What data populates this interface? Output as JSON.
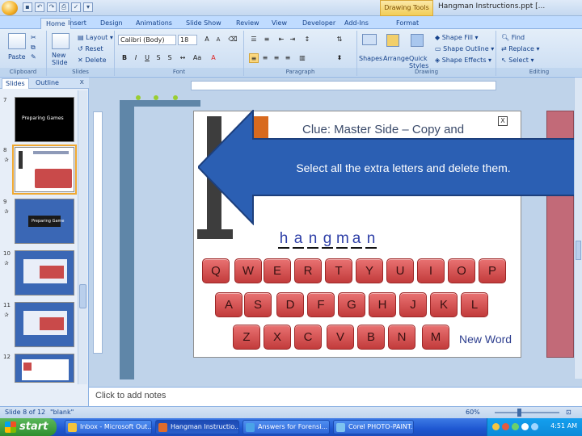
{
  "titlebar": {
    "context_tab": "Drawing Tools",
    "document_title": "Hangman Instructions.ppt [..."
  },
  "ribbon_tabs": [
    "Home",
    "Insert",
    "Design",
    "Animations",
    "Slide Show",
    "Review",
    "View",
    "Developer",
    "Add-Ins",
    "Format"
  ],
  "ribbon": {
    "clipboard": {
      "paste": "Paste",
      "label": "Clipboard"
    },
    "slides": {
      "new_slide": "New Slide",
      "layout": "Layout",
      "reset": "Reset",
      "delete": "Delete",
      "label": "Slides"
    },
    "font": {
      "font_name": "Calibri (Body)",
      "font_size": "18",
      "label": "Font"
    },
    "paragraph": {
      "label": "Paragraph"
    },
    "drawing": {
      "shapes": "Shapes",
      "arrange": "Arrange",
      "quick_styles": "Quick Styles",
      "shape_fill": "Shape Fill",
      "shape_outline": "Shape Outline",
      "shape_effects": "Shape Effects",
      "label": "Drawing"
    },
    "editing": {
      "find": "Find",
      "replace": "Replace",
      "select": "Select",
      "label": "Editing"
    }
  },
  "slides_pane": {
    "tabs": [
      "Slides",
      "Outline"
    ],
    "close": "x",
    "thumbnails": [
      {
        "num": "7",
        "caption": "Preparing Games"
      },
      {
        "num": "8",
        "caption": ""
      },
      {
        "num": "9",
        "caption": "Preparing Game"
      },
      {
        "num": "10",
        "caption": ""
      },
      {
        "num": "11",
        "caption": ""
      },
      {
        "num": "12",
        "caption": ""
      }
    ]
  },
  "slide": {
    "clue": "Clue: Master Side – Copy and",
    "close_box": "X",
    "word_letters": [
      "h",
      "a",
      "n",
      "g",
      "m",
      "a",
      "n"
    ],
    "keyboard_rows": [
      [
        "Q",
        "W",
        "E",
        "R",
        "T",
        "Y",
        "U",
        "I",
        "O",
        "P"
      ],
      [
        "A",
        "S",
        "D",
        "F",
        "G",
        "H",
        "J",
        "K",
        "L"
      ],
      [
        "Z",
        "X",
        "C",
        "V",
        "B",
        "N",
        "M"
      ]
    ],
    "new_word": "New Word"
  },
  "callout": {
    "text": "Select all the extra letters and delete them."
  },
  "notes": {
    "placeholder": "Click to add notes"
  },
  "statusbar": {
    "slide_info": "Slide 8 of 12",
    "theme": "\"blank\"",
    "zoom": "60%"
  },
  "taskbar": {
    "start": "start",
    "tasks": [
      "Inbox - Microsoft Out...",
      "Hangman Instructio...",
      "Answers for Forensi...",
      "Corel PHOTO-PAINT..."
    ],
    "clock": "4:51 AM"
  },
  "colors": {
    "key_red": "#c23b3b",
    "callout_blue": "#2b5fb3",
    "word_blue": "#2e3fa7"
  }
}
